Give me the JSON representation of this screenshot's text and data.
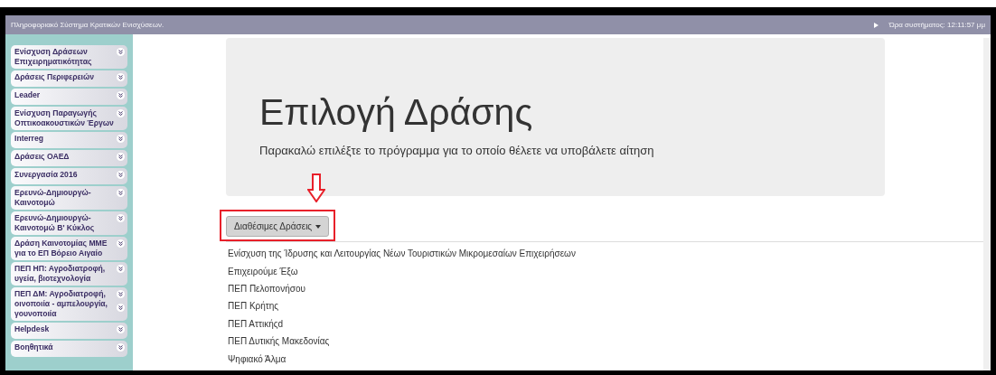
{
  "header": {
    "title": "Πληροφοριακό Σύστημα Κρατικών Ενισχύσεων.",
    "clock": "Ώρα συστήματος: 12:11:57 μμ"
  },
  "sidebar": {
    "items": [
      {
        "label": "Ενίσχυση Δράσεων Επιχειρηματικότητας",
        "kind": "chevron"
      },
      {
        "label": "Δράσεις Περιφερειών",
        "kind": "chevron"
      },
      {
        "label": "Leader",
        "kind": "chevron"
      },
      {
        "label": "Ενίσχυση Παραγωγής Οπτικοακουστικών Έργων",
        "kind": "chevron"
      },
      {
        "label": "Interreg",
        "kind": "chevron"
      },
      {
        "label": "Δράσεις ΟΑΕΔ",
        "kind": "chevron"
      },
      {
        "label": "Συνεργασία 2016",
        "kind": "chevron"
      },
      {
        "label": "Ερευνώ-Δημιουργώ-Καινοτομώ",
        "kind": "chevron"
      },
      {
        "label": "Ερευνώ-Δημιουργώ-Καινοτομώ Β' Κύκλος",
        "kind": "chevron"
      },
      {
        "label": "Δράση Καινοτομίας ΜΜΕ για το ΕΠ Βόρειο Αιγαίο",
        "kind": "chevron"
      },
      {
        "label": "ΠΕΠ ΗΠ: Αγροδιατροφή, υγεία, βιοτεχνολογία",
        "kind": "chevron"
      },
      {
        "label": "ΠΕΠ ΔΜ: Αγροδιατροφή, οινοποιία - αμπελουργία, γουνοποιία",
        "kind": "double"
      },
      {
        "label": "Helpdesk",
        "kind": "chevron"
      },
      {
        "label": "Βοηθητικά",
        "kind": "chevron"
      }
    ]
  },
  "jumbotron": {
    "title": "Επιλογή Δράσης",
    "subtitle": "Παρακαλώ επιλέξτε το πρόγραμμα για το οποίο θέλετε να υποβάλετε αίτηση"
  },
  "dropdown": {
    "label": "Διαθέσιμες Δράσεις",
    "expanded": true,
    "highlighted": true,
    "items": [
      "Ενίσχυση της Ίδρυσης και Λειτουργίας Νέων Τουριστικών Μικρομεσαίων Επιχειρήσεων",
      "Επιχειρούμε Έξω",
      "ΠΕΠ Πελοπονήσου",
      "ΠΕΠ Κρήτης",
      "ΠΕΠ Αττικήςd",
      "ΠΕΠ Δυτικής Μακεδονίας",
      "Ψηφιακό Άλμα"
    ]
  }
}
